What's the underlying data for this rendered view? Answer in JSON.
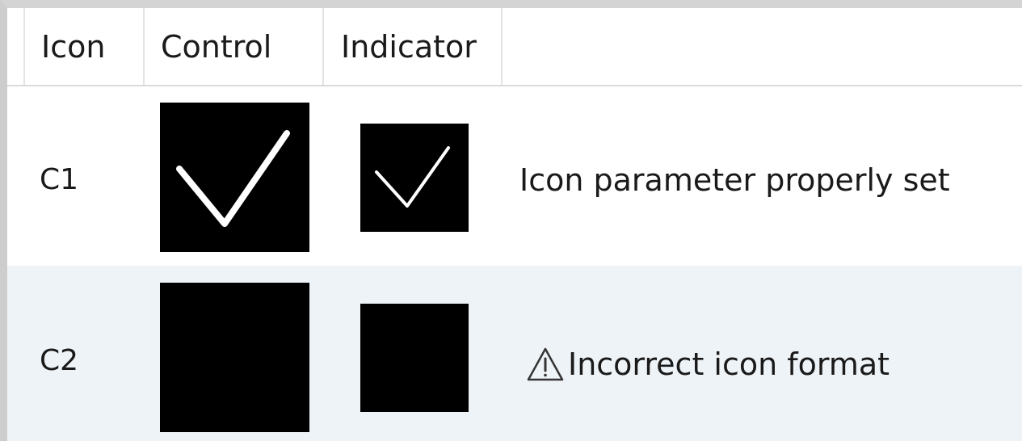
{
  "table": {
    "columns": [
      "Icon",
      "Control",
      "Indicator"
    ],
    "rows": [
      {
        "id": "C1",
        "control_image": "checkmark-white-on-black",
        "indicator_image": "checkmark-white-on-black",
        "description": "Icon parameter properly set",
        "status_icon": null
      },
      {
        "id": "C2",
        "control_image": "solid-black",
        "indicator_image": "solid-black",
        "description": "Incorrect icon format",
        "status_icon": "warning-triangle-icon"
      }
    ]
  },
  "colors": {
    "header_bg": "#ffffff",
    "row1_bg": "#ffffff",
    "row2_bg": "#eef3f7",
    "icon_bg": "#000000",
    "checkmark": "#ffffff"
  }
}
